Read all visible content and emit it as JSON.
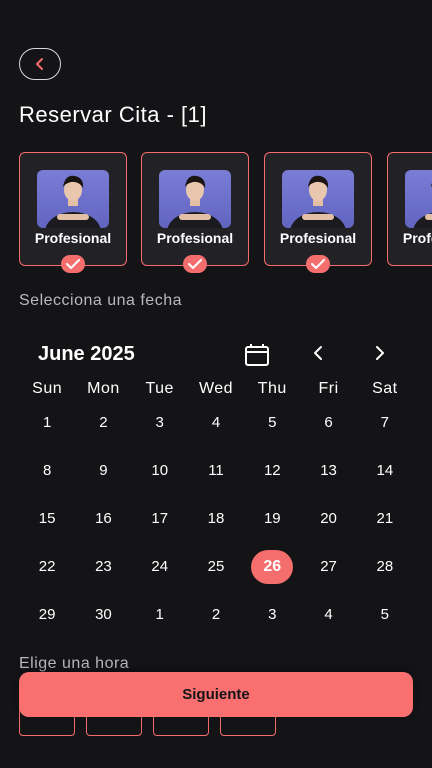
{
  "header": {
    "title": "Reservar Cita - [1]"
  },
  "professionals": [
    {
      "label": "Profesional",
      "selected": true
    },
    {
      "label": "Profesional",
      "selected": true
    },
    {
      "label": "Profesional",
      "selected": true
    },
    {
      "label": "Profesional",
      "selected": true
    }
  ],
  "date_section": {
    "label": "Selecciona una fecha"
  },
  "calendar": {
    "month": "June 2025",
    "weekdays": [
      "Sun",
      "Mon",
      "Tue",
      "Wed",
      "Thu",
      "Fri",
      "Sat"
    ],
    "weeks": [
      [
        "1",
        "2",
        "3",
        "4",
        "5",
        "6",
        "7"
      ],
      [
        "8",
        "9",
        "10",
        "11",
        "12",
        "13",
        "14"
      ],
      [
        "15",
        "16",
        "17",
        "18",
        "19",
        "20",
        "21"
      ],
      [
        "22",
        "23",
        "24",
        "25",
        "26",
        "27",
        "28"
      ],
      [
        "29",
        "30",
        "1",
        "2",
        "3",
        "4",
        "5"
      ]
    ],
    "selected_day": "26"
  },
  "time_section": {
    "label": "Elige una hora"
  },
  "footer": {
    "next_label": "Siguiente"
  },
  "colors": {
    "background": "#141417",
    "accent": "#fa7070",
    "card": "#222226"
  }
}
